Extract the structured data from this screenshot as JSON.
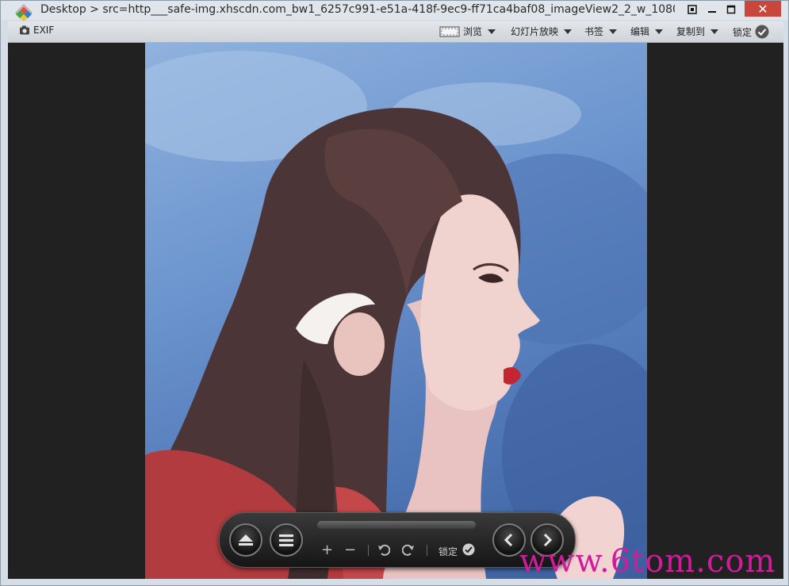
{
  "window": {
    "title": "Desktop > src=http___safe-img.xhscdn.com_bw1_6257c991-e51a-418f-9ec9-ff71ca4baf08_imageView2_2_w_1080_format_jpg..."
  },
  "toolbar": {
    "exif_label": "EXIF",
    "browse_label": "浏览",
    "slideshow_label": "幻灯片放映",
    "bookmarks_label": "书签",
    "edit_label": "编辑",
    "copy_to_label": "复制到",
    "lock_label": "锁定"
  },
  "controls": {
    "lock_label": "锁定"
  },
  "watermark": {
    "text": "www.6tom.com"
  },
  "colors": {
    "viewer_bg": "#212121",
    "close_button": "#c9463d",
    "watermark": "#d11b9b"
  }
}
